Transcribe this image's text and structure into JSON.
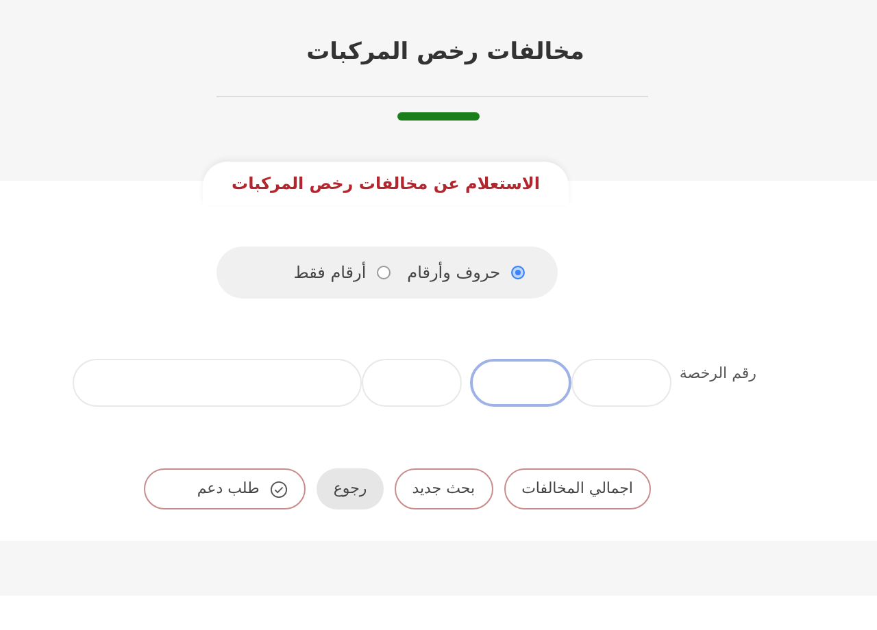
{
  "header": {
    "title": "مخالفات رخص المركبات"
  },
  "tab": {
    "label": "الاستعلام عن مخالفات رخص المركبات"
  },
  "radios": [
    {
      "label": "حروف وأرقام",
      "selected": true
    },
    {
      "label": "أرقام فقط",
      "selected": false
    }
  ],
  "license": {
    "label": "رقم الرخصة",
    "fields": [
      {
        "focused": false
      },
      {
        "focused": true
      },
      {
        "focused": false
      },
      {
        "focused": false
      }
    ]
  },
  "buttons": [
    {
      "label": "اجمالي المخالفات",
      "kind": "outline"
    },
    {
      "label": "بحث جديد",
      "kind": "outline"
    },
    {
      "label": "رجوع",
      "kind": "muted"
    },
    {
      "label": "طلب دعم",
      "kind": "icon"
    }
  ]
}
